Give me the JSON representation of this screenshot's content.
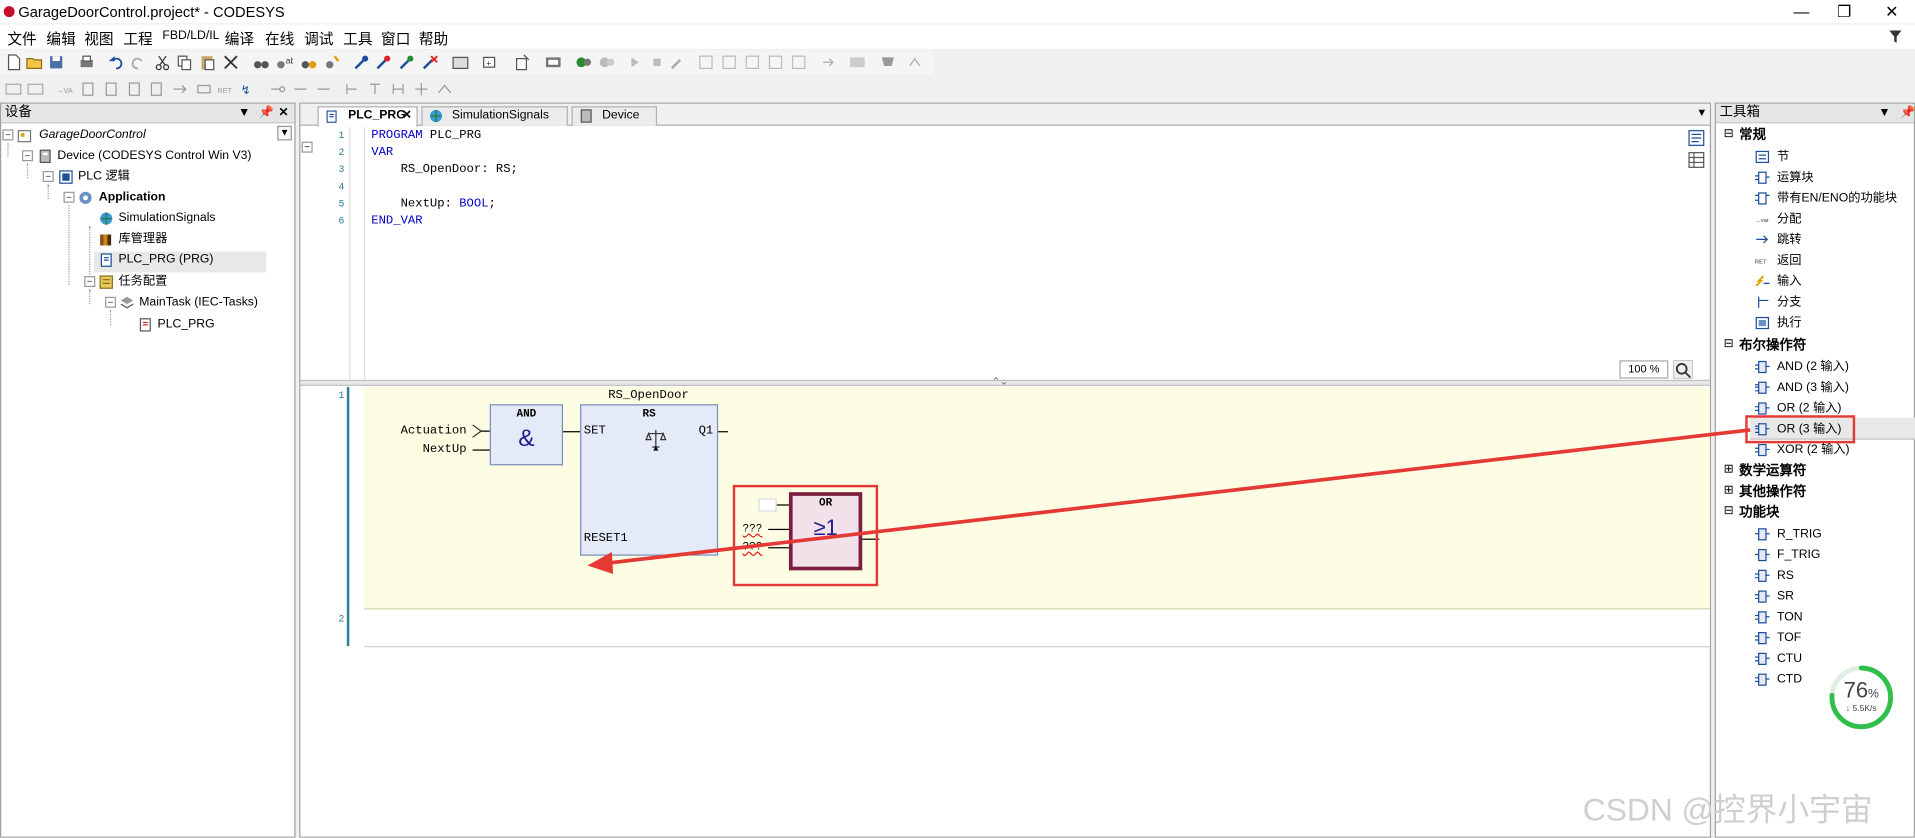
{
  "window": {
    "title": "GarageDoorControl.project* - CODESYS",
    "controls": {
      "minimize": "—",
      "maximize": "❐",
      "close": "✕"
    }
  },
  "menu": [
    "文件",
    "编辑",
    "视图",
    "工程",
    "FBD/LD/IL",
    "编译",
    "在线",
    "调试",
    "工具",
    "窗口",
    "帮助"
  ],
  "devices_panel": {
    "title": "设备",
    "tree": [
      {
        "label": "GarageDoorControl",
        "icon": "project-icon",
        "italic": true
      },
      {
        "label": "Device (CODESYS Control Win V3)",
        "icon": "device-icon"
      },
      {
        "label": "PLC 逻辑",
        "icon": "plc-logic-icon"
      },
      {
        "label": "Application",
        "icon": "application-gear-icon",
        "bold": true
      },
      {
        "label": "SimulationSignals",
        "icon": "globe-icon"
      },
      {
        "label": "库管理器",
        "icon": "library-icon"
      },
      {
        "label": "PLC_PRG (PRG)",
        "icon": "program-icon",
        "selected": true
      },
      {
        "label": "任务配置",
        "icon": "task-config-icon"
      },
      {
        "label": "MainTask (IEC-Tasks)",
        "icon": "task-icon"
      },
      {
        "label": "PLC_PRG",
        "icon": "program-call-icon"
      }
    ]
  },
  "editor": {
    "tabs": [
      {
        "label": "PLC_PRG",
        "active": true,
        "close": "✕"
      },
      {
        "label": "SimulationSignals"
      },
      {
        "label": "Device"
      }
    ],
    "declaration": {
      "lines": [
        {
          "no": "1",
          "parts": [
            {
              "t": "PROGRAM",
              "kw": true
            },
            {
              "t": " PLC_PRG"
            }
          ]
        },
        {
          "no": "2",
          "parts": [
            {
              "t": "VAR",
              "kw": true
            }
          ]
        },
        {
          "no": "3",
          "parts": [
            {
              "t": "    RS_OpenDoor: RS;"
            }
          ]
        },
        {
          "no": "4",
          "parts": [
            {
              "t": ""
            }
          ]
        },
        {
          "no": "5",
          "parts": [
            {
              "t": "    NextUp: "
            },
            {
              "t": "BOOL",
              "kw": true
            },
            {
              "t": ";"
            }
          ]
        },
        {
          "no": "6",
          "parts": [
            {
              "t": "END_VAR",
              "kw": true
            }
          ]
        }
      ]
    },
    "zoom": "100 %",
    "networks": [
      {
        "no": "1",
        "instance_name": "RS_OpenDoor",
        "and_block": {
          "name": "AND",
          "symbol": "&",
          "inputs": [
            "Actuation",
            "NextUp"
          ]
        },
        "rs_block": {
          "name": "RS",
          "inputs": [
            "SET",
            "RESET1"
          ],
          "output": "Q1"
        },
        "or_block": {
          "name": "OR",
          "symbol": "≥1",
          "inputs": [
            "",
            "???",
            "???"
          ]
        }
      },
      {
        "no": "2"
      }
    ]
  },
  "toolbox": {
    "title": "工具箱",
    "categories": [
      {
        "label": "常规",
        "expanded": true,
        "exp": "⊟",
        "items": [
          {
            "label": "节",
            "icon": "network-icon"
          },
          {
            "label": "运算块",
            "icon": "box-icon"
          },
          {
            "label": "带有EN/ENO的功能块",
            "icon": "box-en-icon"
          },
          {
            "label": "分配",
            "icon": "assignment-icon",
            "iconText": "→var"
          },
          {
            "label": "跳转",
            "icon": "jump-icon"
          },
          {
            "label": "返回",
            "icon": "return-icon",
            "iconText": "RET"
          },
          {
            "label": "输入",
            "icon": "input-icon"
          },
          {
            "label": "分支",
            "icon": "branch-icon"
          },
          {
            "label": "执行",
            "icon": "execute-icon"
          }
        ]
      },
      {
        "label": "布尔操作符",
        "expanded": true,
        "exp": "⊟",
        "items": [
          {
            "label": "AND (2 输入)",
            "icon": "and-icon"
          },
          {
            "label": "AND (3 输入)",
            "icon": "and-icon"
          },
          {
            "label": "OR (2 输入)",
            "icon": "or-icon"
          },
          {
            "label": "OR (3 输入)",
            "icon": "or-icon",
            "highlighted": true
          },
          {
            "label": "XOR (2 输入)",
            "icon": "xor-icon"
          }
        ]
      },
      {
        "label": "数学运算符",
        "expanded": false,
        "exp": "⊞",
        "items": []
      },
      {
        "label": "其他操作符",
        "expanded": false,
        "exp": "⊞",
        "items": []
      },
      {
        "label": "功能块",
        "expanded": true,
        "exp": "⊟",
        "items": [
          {
            "label": "R_TRIG",
            "icon": "fb-icon"
          },
          {
            "label": "F_TRIG",
            "icon": "fb-icon"
          },
          {
            "label": "RS",
            "icon": "fb-icon"
          },
          {
            "label": "SR",
            "icon": "fb-icon"
          },
          {
            "label": "TON",
            "icon": "fb-icon"
          },
          {
            "label": "TOF",
            "icon": "fb-icon"
          },
          {
            "label": "CTU",
            "icon": "fb-icon"
          },
          {
            "label": "CTD",
            "icon": "fb-icon"
          }
        ]
      }
    ]
  },
  "network_widget": {
    "percent": "76",
    "unit": "%",
    "speed": "↓ 5.5K/s",
    "percent_value": 0.76
  },
  "watermark": "CSDN @控界小宇宙",
  "colors": {
    "annotation": "#e53935",
    "keyword": "#0000c0",
    "fbd_background": "#fdfde3",
    "block_fill": "#e4eaf7"
  }
}
